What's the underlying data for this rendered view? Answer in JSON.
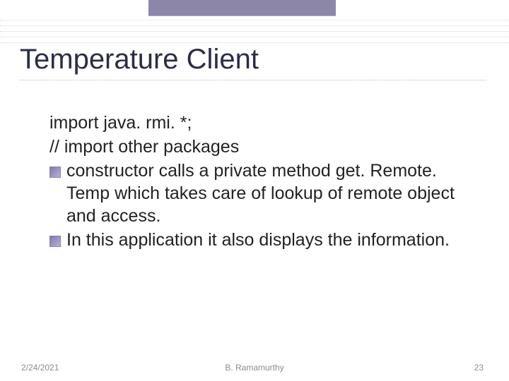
{
  "slide": {
    "title": "Temperature Client",
    "plain_lines": [
      "import java. rmi. *;",
      " // import other packages"
    ],
    "bullets": [
      "constructor calls a private method get. Remote. Temp which takes care of lookup of remote object and access.",
      "In this application it also displays the information."
    ]
  },
  "footer": {
    "date": "2/24/2021",
    "author": "B. Ramamurthy",
    "page": "23"
  },
  "decor": {
    "hline_positions": [
      28,
      36,
      44,
      52,
      60
    ]
  }
}
